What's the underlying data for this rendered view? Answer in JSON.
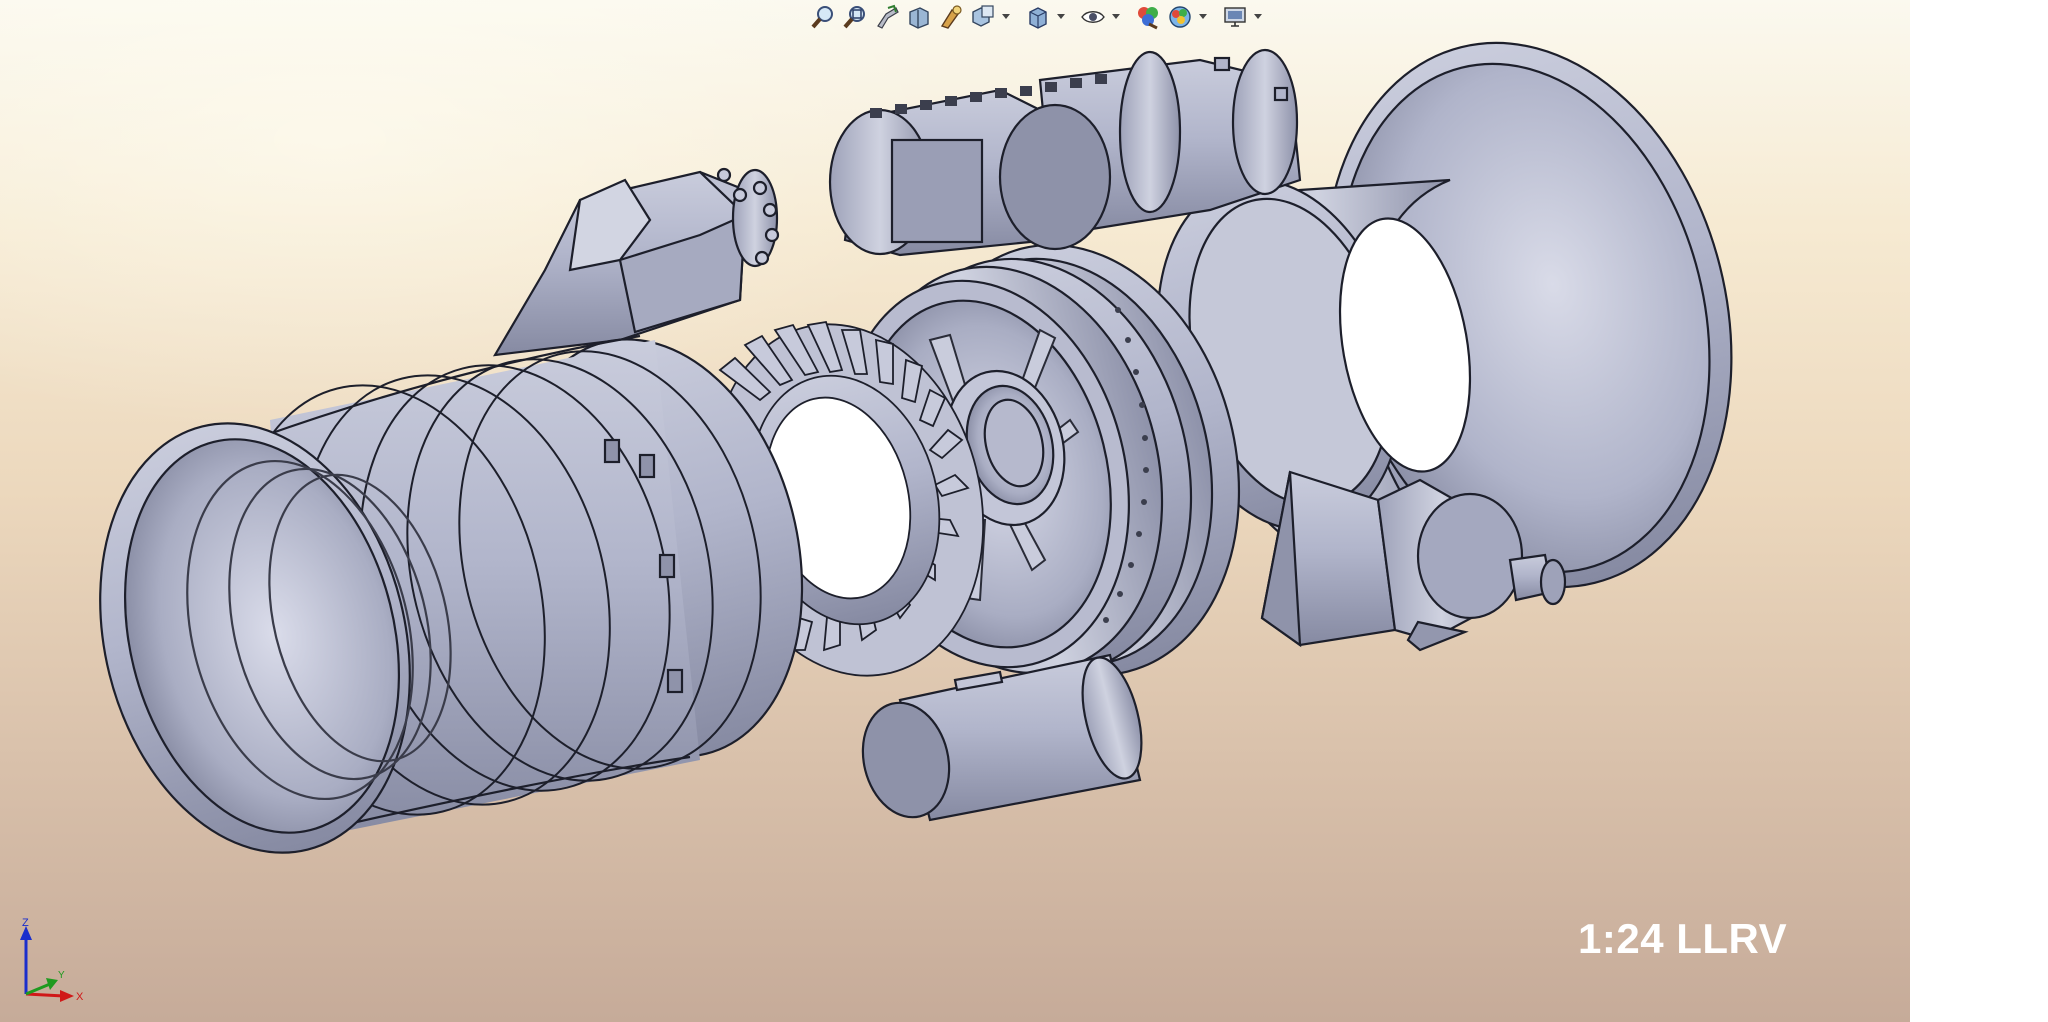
{
  "view": {
    "scale_label": "1:24 LLRV",
    "background_top": "#fbf9ef",
    "background_bottom": "#c6ab99",
    "part_color": "#b2b6cc"
  },
  "toolbar": {
    "items": [
      {
        "name": "zoom-to-fit-icon"
      },
      {
        "name": "zoom-to-area-icon"
      },
      {
        "name": "previous-view-icon"
      },
      {
        "name": "section-view-icon"
      },
      {
        "name": "dynamic-annotation-icon"
      },
      {
        "name": "view-orientation-icon",
        "dropdown": true
      },
      {
        "name": "display-style-icon",
        "dropdown": true
      },
      {
        "name": "hide-show-items-icon",
        "dropdown": true
      },
      {
        "name": "edit-appearance-icon"
      },
      {
        "name": "apply-scene-icon",
        "dropdown": true
      },
      {
        "name": "view-settings-icon",
        "dropdown": true
      }
    ]
  },
  "triad": {
    "z_label": "Z",
    "y_label": "Y",
    "x_label": "X",
    "z_color": "#1a2ecc",
    "y_color": "#1f9a1f",
    "x_color": "#d01818"
  }
}
